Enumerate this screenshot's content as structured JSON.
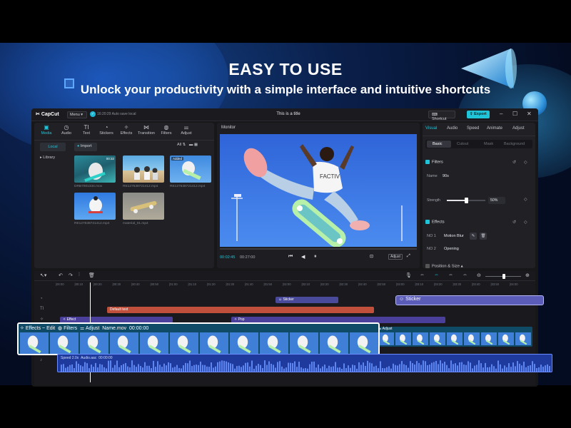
{
  "promo": {
    "headline": "EASY TO USE",
    "subheadline": "Unlock your productivity with a simple interface and intuitive shortcuts"
  },
  "app": {
    "name": "CapCut",
    "menu_label": "Menu",
    "save_status": "16:20:29 Auto save local",
    "window_title": "This is a title",
    "shortcut_label": "Shortcut",
    "export_label": "Export"
  },
  "media_tools": [
    {
      "label": "Media",
      "icon": "media-icon",
      "active": true
    },
    {
      "label": "Audio",
      "icon": "audio-icon"
    },
    {
      "label": "Text",
      "icon": "text-icon"
    },
    {
      "label": "Stickers",
      "icon": "stickers-icon"
    },
    {
      "label": "Effects",
      "icon": "effects-icon"
    },
    {
      "label": "Transition",
      "icon": "transition-icon"
    },
    {
      "label": "Filters",
      "icon": "filters-icon"
    },
    {
      "label": "Adjust",
      "icon": "adjust-icon"
    }
  ],
  "media_panel": {
    "local_label": "Local",
    "library_label": "Library",
    "import_label": "Import",
    "sort_label": "All",
    "items": [
      {
        "caption": "DRB7001334.mov",
        "duration": "00:32"
      },
      {
        "caption": "RE127538721412.mp4",
        "duration": ""
      },
      {
        "caption": "RE127538721412.mp4",
        "added": "Added"
      },
      {
        "caption": "RE127538721412.mp4",
        "duration": ""
      },
      {
        "caption": "material_01.mp4",
        "duration": ""
      }
    ]
  },
  "monitor": {
    "title": "Monitor",
    "time_current": "00:02:45",
    "time_total": "00:27:00",
    "adjust_label": "Adjust"
  },
  "inspector": {
    "tabs": [
      "Visual",
      "Audio",
      "Speed",
      "Animate",
      "Adjust"
    ],
    "subtabs": [
      "Basic",
      "Cutout",
      "Mask",
      "Background"
    ],
    "filters_title": "Filters",
    "filter_name_label": "Name",
    "filter_name_value": "90s",
    "strength_label": "Strength",
    "strength_value": "50%",
    "strength_fraction": 0.5,
    "effects_title": "Effects",
    "effects": [
      {
        "slot": "NO 1",
        "name": "Motion Blur"
      },
      {
        "slot": "NO 2",
        "name": "Opening"
      }
    ],
    "position_title": "Position & Size"
  },
  "timeline": {
    "ruler": [
      "00:00",
      "00:10",
      "00:20",
      "00:30",
      "00:40",
      "00:50",
      "01:00",
      "01:10",
      "01:20",
      "01:30",
      "01:40",
      "01:50",
      "02:00",
      "02:10",
      "02:20",
      "02:30",
      "02:40",
      "02:50",
      "03:00",
      "03:10",
      "03:20",
      "03:30",
      "03:40",
      "03:50",
      "04:00"
    ],
    "sticker_clip": "Sticker",
    "sticker_clip_highlight": "Sticker",
    "text_clip": "Default text",
    "effect_clip_1": "Effect",
    "effect_clip_2": "Pop",
    "adjust_clip": "Adjust",
    "overlay_header": {
      "effects": "Effects ~ Edit",
      "filters": "Filters",
      "adjust": "Adjust",
      "name": "Name.mov",
      "time": "00:00:00"
    },
    "audio_label": "Speed 2.0x",
    "audio_name": "Audio.aac",
    "audio_time": "00:00:00"
  },
  "colors": {
    "accent": "#20c4d8",
    "sticker_clip": "#5b5bb8",
    "text_clip": "#c0503c",
    "effect_clip": "#4a3f9a",
    "video_track": "#0f4a66",
    "audio_track": "#1d3a9c"
  }
}
